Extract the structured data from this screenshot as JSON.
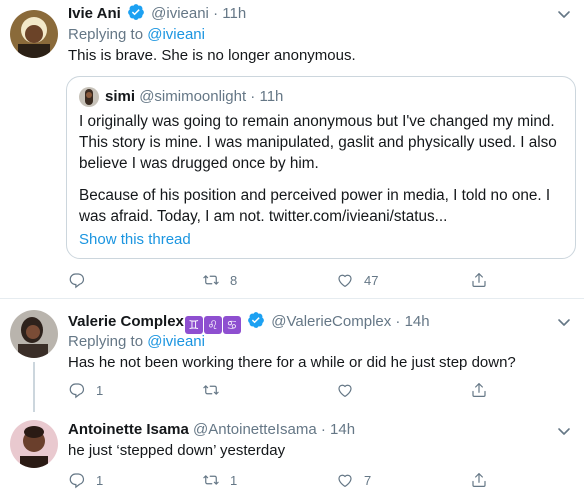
{
  "tweets": [
    {
      "name": "Ivie Ani",
      "handle": "@ivieani",
      "time": "11h",
      "replying_prefix": "Replying to ",
      "replying_to": "@ivieani",
      "text": "This is brave. She is no longer anonymous.",
      "quote": {
        "name": "simi",
        "handle": "@simimoonlight",
        "time": "11h",
        "lines": [
          "I originally was going to remain anonymous but I've changed my mind.",
          "This story is mine. I was manipulated, gaslit and physically used. I also",
          "believe I was drugged once by him.",
          "",
          "Because of his position and perceived power in media, I told no one. I",
          "was afraid. Today, I am not. twitter.com/ivieani/status..."
        ],
        "show_thread": "Show this thread"
      },
      "reply_count": "",
      "retweet_count": "8",
      "like_count": "47"
    },
    {
      "name": "Valerie Complex",
      "zodiac": [
        "♊",
        "♌",
        "♋"
      ],
      "handle": "@ValerieComplex",
      "time": "14h",
      "replying_prefix": "Replying to ",
      "replying_to": "@ivieani",
      "text": "Has he not been working there for a while or did he just step down?",
      "reply_count": "1",
      "retweet_count": "",
      "like_count": ""
    },
    {
      "name": "Antoinette Isama",
      "handle": "@AntoinetteIsama",
      "time": "14h",
      "text": "he just ‘stepped down’ yesterday",
      "reply_count": "1",
      "retweet_count": "1",
      "like_count": "7"
    }
  ],
  "separator": "·",
  "colors": {
    "accent": "#1da1f2",
    "link": "#1b95e0",
    "muted": "#657786",
    "zodiac": "#8e4fd0"
  }
}
